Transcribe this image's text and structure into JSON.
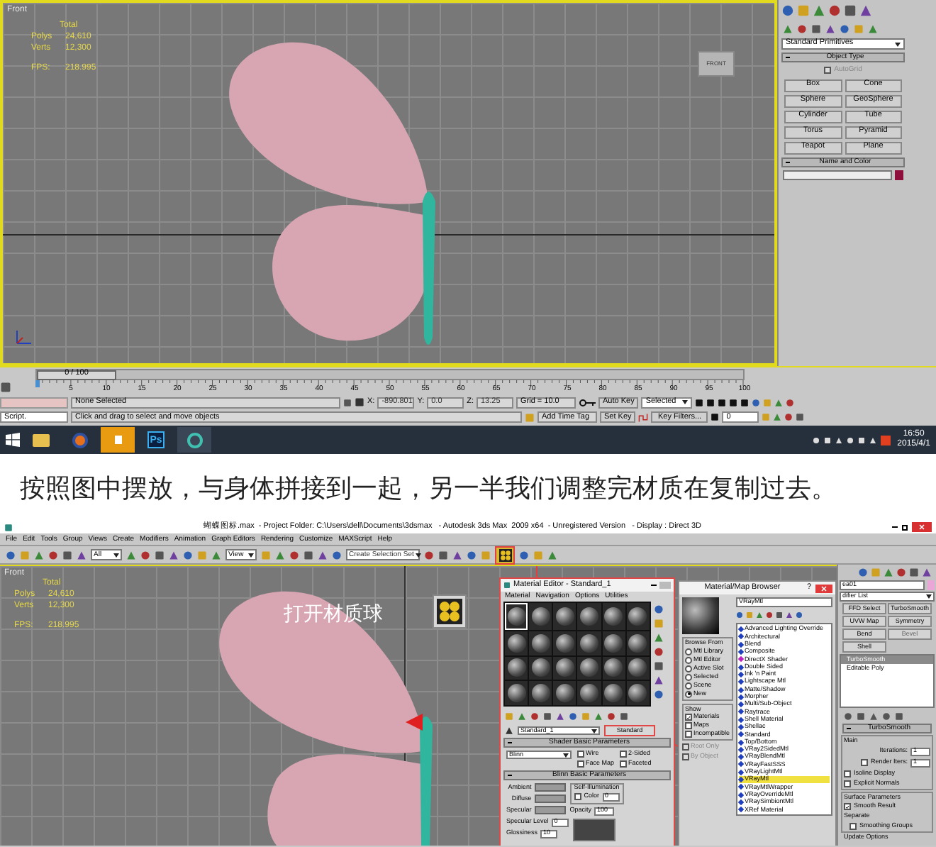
{
  "screenshot_1": {
    "viewport": {
      "name": "Front",
      "stats_header": "Total",
      "stats": [
        {
          "label": "Polys",
          "value": "24,610"
        },
        {
          "label": "Verts",
          "value": "12,300"
        },
        {
          "label": "FPS:",
          "value": "218.995"
        }
      ],
      "view_cube": "FRONT"
    },
    "command_panel": {
      "dropdown": "Standard Primitives",
      "object_type": {
        "title": "Object Type",
        "autogrid": {
          "label": "AutoGrid",
          "checked": false
        },
        "buttons": [
          "Box",
          "Cone",
          "Sphere",
          "GeoSphere",
          "Cylinder",
          "Tube",
          "Torus",
          "Pyramid",
          "Teapot",
          "Plane"
        ]
      },
      "name_and_color": {
        "title": "Name and Color"
      }
    },
    "time_slider": {
      "label": "0 / 100",
      "level": 0
    },
    "ruler": {
      "ticks": [
        "5",
        "10",
        "15",
        "20",
        "25",
        "30",
        "35",
        "40",
        "45",
        "50",
        "55",
        "60",
        "65",
        "70",
        "75",
        "80",
        "85",
        "90",
        "95",
        "100"
      ]
    },
    "status": {
      "script": "Script.",
      "selection": "None Selected",
      "x": {
        "label": "X:",
        "value": "-890.801"
      },
      "y": {
        "label": "Y:",
        "value": "0.0"
      },
      "z": {
        "label": "Z:",
        "value": "13.25"
      },
      "grid": "Grid = 10.0",
      "auto_key": "Auto Key",
      "key_mode": "Selected",
      "set_key": "Set Key",
      "key_filters": "Key Filters...",
      "frame": "0",
      "prompt": "Click and drag to select and move objects",
      "time_tag": "Add Time Tag"
    },
    "taskbar": {
      "apps": [
        {
          "kind": "explorer"
        },
        {
          "kind": "firefox"
        },
        {
          "kind": "speaker"
        },
        {
          "kind": "photoshop",
          "label": "Ps"
        },
        {
          "kind": "app"
        }
      ],
      "time": "16:50",
      "date": "2015/4/1"
    }
  },
  "caption": "按照图中摆放，与身体拼接到一起，另一半我们调整完材质在复制过去。",
  "screenshot_2": {
    "title": "蝴蝶图标.max  - Project Folder: C:\\Users\\dell\\Documents\\3dsmax   - Autodesk 3ds Max  2009 x64  - Unregistered Version   - Display : Direct 3D",
    "menu": [
      "File",
      "Edit",
      "Tools",
      "Group",
      "Views",
      "Create",
      "Modifiers",
      "Animation",
      "Graph Editors",
      "Rendering",
      "Customize",
      "MAXScript",
      "Help"
    ],
    "toolbar": {
      "selection_filter": "All",
      "coordinate_system": "View",
      "selection_set": "Create Selection Set"
    },
    "viewport": {
      "name": "Front",
      "stats_header": "Total",
      "stats": [
        {
          "label": "Polys",
          "value": "24,610"
        },
        {
          "label": "Verts",
          "value": "12,300"
        },
        {
          "label": "FPS:",
          "value": "218.995"
        }
      ]
    },
    "annotation": "打开材质球",
    "material_editor": {
      "title": "Material Editor - Standard_1",
      "menu": [
        "Material",
        "Navigation",
        "Options",
        "Utilities"
      ],
      "slots": [
        {
          "selected": true
        },
        {
          "selected": false
        },
        {
          "selected": false
        },
        {
          "selected": false
        },
        {
          "selected": false
        },
        {
          "selected": false
        },
        {
          "selected": false
        },
        {
          "selected": false
        },
        {
          "selected": false
        },
        {
          "selected": false
        },
        {
          "selected": false
        },
        {
          "selected": false
        },
        {
          "selected": false
        },
        {
          "selected": false
        },
        {
          "selected": false
        },
        {
          "selected": false
        },
        {
          "selected": false
        },
        {
          "selected": false
        },
        {
          "selected": false
        },
        {
          "selected": false
        },
        {
          "selected": false
        },
        {
          "selected": false
        },
        {
          "selected": false
        },
        {
          "selected": false
        }
      ],
      "material_name": "Standard_1",
      "type_button": "Standard",
      "shader_rollout": "Shader Basic Parameters",
      "shader": "Blinn",
      "options": [
        {
          "label": "Wire",
          "checked": false
        },
        {
          "label": "2-Sided",
          "checked": false
        },
        {
          "label": "Face Map",
          "checked": false
        },
        {
          "label": "Faceted",
          "checked": false
        }
      ],
      "basic_rollout": "Blinn Basic Parameters",
      "colors": [
        "Ambient",
        "Diffuse",
        "Specular"
      ],
      "self_illumination": {
        "title": "Self-Illumination",
        "label": "Color",
        "checked": false,
        "value": "0"
      },
      "opacity": {
        "label": "Opacity",
        "value": "100"
      },
      "specular_level": {
        "label": "Specular Level",
        "value": "0"
      },
      "glossiness": {
        "label": "Glossiness",
        "value": "10"
      }
    },
    "browser": {
      "title": "Material/Map Browser",
      "help": "?",
      "search": "VRayMtl",
      "browse_from": {
        "title": "Browse From",
        "options": [
          {
            "label": "Mtl Library",
            "selected": false
          },
          {
            "label": "Mtl Editor",
            "selected": false
          },
          {
            "label": "Active Slot",
            "selected": false
          },
          {
            "label": "Selected",
            "selected": false
          },
          {
            "label": "Scene",
            "selected": false
          },
          {
            "label": "New",
            "selected": true
          }
        ]
      },
      "show": {
        "title": "Show",
        "options": [
          {
            "label": "Materials",
            "checked": true
          },
          {
            "label": "Maps",
            "checked": false
          },
          {
            "label": "Incompatible",
            "checked": false
          }
        ]
      },
      "filters": [
        {
          "label": "Root Only",
          "checked": false
        },
        {
          "label": "By Object",
          "checked": false
        }
      ],
      "items": [
        {
          "label": "Advanced Lighting Override",
          "color": "#1f3fbf",
          "selected": false
        },
        {
          "label": "Architectural",
          "color": "#1f3fbf",
          "selected": false
        },
        {
          "label": "Blend",
          "color": "#1f3fbf",
          "selected": false
        },
        {
          "label": "Composite",
          "color": "#1f3fbf",
          "selected": false
        },
        {
          "label": "DirectX Shader",
          "color": "#c21fc2",
          "selected": false
        },
        {
          "label": "Double Sided",
          "color": "#1f3fbf",
          "selected": false
        },
        {
          "label": "Ink 'n Paint",
          "color": "#1f3fbf",
          "selected": false
        },
        {
          "label": "Lightscape Mtl",
          "color": "#1f3fbf",
          "selected": false
        },
        {
          "label": "Matte/Shadow",
          "color": "#1f3fbf",
          "selected": false
        },
        {
          "label": "Morpher",
          "color": "#1f3fbf",
          "selected": false
        },
        {
          "label": "Multi/Sub-Object",
          "color": "#1f3fbf",
          "selected": false
        },
        {
          "label": "Raytrace",
          "color": "#1f3fbf",
          "selected": false
        },
        {
          "label": "Shell Material",
          "color": "#1f3fbf",
          "selected": false
        },
        {
          "label": "Shellac",
          "color": "#1f3fbf",
          "selected": false
        },
        {
          "label": "Standard",
          "color": "#1f3fbf",
          "selected": false
        },
        {
          "label": "Top/Bottom",
          "color": "#1f3fbf",
          "selected": false
        },
        {
          "label": "VRay2SidedMtl",
          "color": "#1f3fbf",
          "selected": false
        },
        {
          "label": "VRayBlendMtl",
          "color": "#1f3fbf",
          "selected": false
        },
        {
          "label": "VRayFastSSS",
          "color": "#1f3fbf",
          "selected": false
        },
        {
          "label": "VRayLightMtl",
          "color": "#1f3fbf",
          "selected": false
        },
        {
          "label": "VRayMtl",
          "color": "#1f3fbf",
          "selected": true
        },
        {
          "label": "VRayMtlWrapper",
          "color": "#1f3fbf",
          "selected": false
        },
        {
          "label": "VRayOverrideMtl",
          "color": "#1f3fbf",
          "selected": false
        },
        {
          "label": "VRaySimbiontMtl",
          "color": "#1f3fbf",
          "selected": false
        },
        {
          "label": "XRef Material",
          "color": "#1f3fbf",
          "selected": false
        }
      ]
    },
    "modify_panel": {
      "object_name": "ea01",
      "modifier_list": "difier List",
      "buttons": [
        {
          "label": "FFD Select",
          "disabled": false
        },
        {
          "label": "TurboSmooth",
          "disabled": false
        },
        {
          "label": "UVW Map",
          "disabled": false
        },
        {
          "label": "Symmetry",
          "disabled": false
        },
        {
          "label": "Bend",
          "disabled": false
        },
        {
          "label": "Bevel",
          "disabled": true
        },
        {
          "label": "Shell",
          "disabled": false
        }
      ],
      "stack": [
        {
          "label": "TurboSmooth",
          "selected": true
        },
        {
          "label": "Editable Poly",
          "selected": false
        }
      ],
      "rollout": "TurboSmooth",
      "main": "Main",
      "iterations": {
        "label": "Iterations:",
        "value": "1"
      },
      "render_iters": {
        "label": "Render Iters:",
        "value": "1",
        "checked": false
      },
      "options": [
        {
          "label": "Isoline Display",
          "checked": false
        },
        {
          "label": "Explicit Normals",
          "checked": false
        }
      ],
      "surface": "Surface Parameters",
      "smooth_result": {
        "label": "Smooth Result",
        "checked": true
      },
      "separate": "Separate",
      "smoothing_groups": {
        "label": "Smoothing Groups",
        "checked": false
      },
      "update": "Update Options"
    }
  }
}
